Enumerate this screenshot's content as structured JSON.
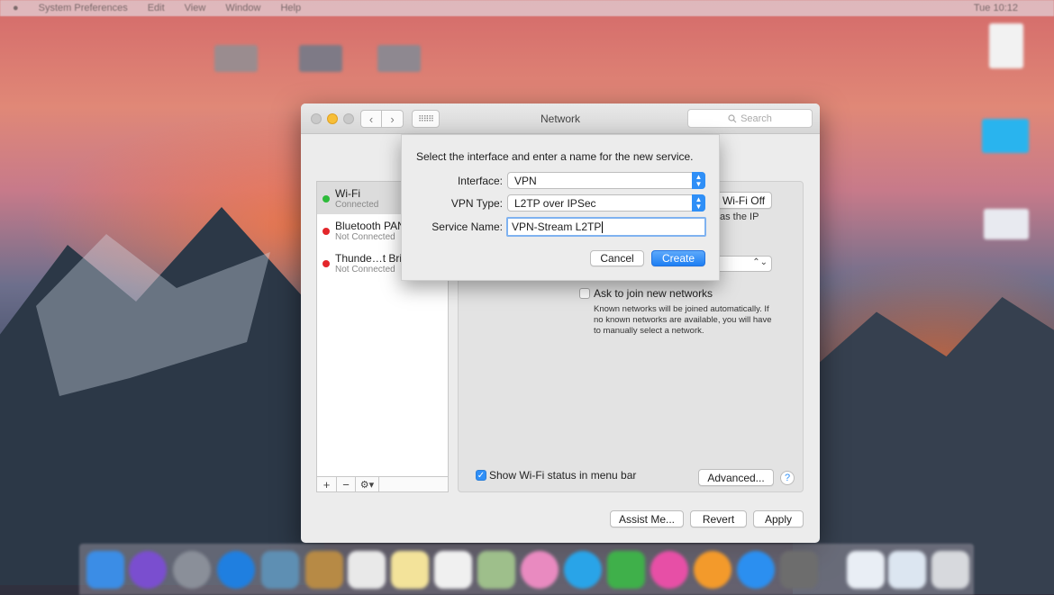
{
  "menubar": {
    "app": "System Preferences",
    "items": [
      "Edit",
      "View",
      "Window",
      "Help"
    ],
    "clock": "Tue 10:12"
  },
  "window": {
    "title": "Network",
    "search_placeholder": "Search"
  },
  "services": [
    {
      "name": "Wi-Fi",
      "status": "Connected",
      "color": "#2dbb3a"
    },
    {
      "name": "Bluetooth PAN",
      "status": "Not Connected",
      "color": "#e3262b"
    },
    {
      "name": "Thunde…t Bridge",
      "status": "Not Connected",
      "color": "#e3262b"
    }
  ],
  "sidebar_tools": {
    "add": "+",
    "remove": "−",
    "gear": "⚙▾"
  },
  "panel": {
    "wifi_off_label": "Wi-Fi Off",
    "partial_text": "as the IP",
    "ask_join_label": "Ask to join new networks",
    "ask_join_note": "Known networks will be joined automatically. If no known networks are available, you will have to manually select a network.",
    "show_status_label": "Show Wi-Fi status in menu bar",
    "advanced_label": "Advanced...",
    "help_label": "?"
  },
  "footer": {
    "assist_label": "Assist Me...",
    "revert_label": "Revert",
    "apply_label": "Apply"
  },
  "sheet": {
    "prompt": "Select the interface and enter a name for the new service.",
    "interface_label": "Interface:",
    "interface_value": "VPN",
    "vpn_type_label": "VPN Type:",
    "vpn_type_value": "L2TP over IPSec",
    "service_name_label": "Service Name:",
    "service_name_value": "VPN-Stream L2TP",
    "cancel_label": "Cancel",
    "create_label": "Create"
  },
  "colors": {
    "accent": "#2f8ff7",
    "connected": "#2dbb3a",
    "not_connected": "#e3262b"
  }
}
